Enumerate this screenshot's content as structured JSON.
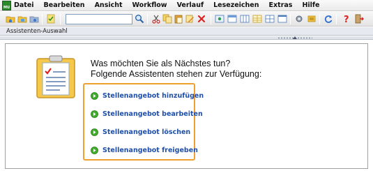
{
  "app": {
    "logo_text": "MU"
  },
  "menu": {
    "items": [
      {
        "label": "Datei"
      },
      {
        "label": "Bearbeiten"
      },
      {
        "label": "Ansicht"
      },
      {
        "label": "Workflow"
      },
      {
        "label": "Verlauf"
      },
      {
        "label": "Lesezeichen"
      },
      {
        "label": "Extras"
      },
      {
        "label": "Hilfe"
      }
    ]
  },
  "toolbar": {
    "search_value": "",
    "icons": [
      "home-folder-icon",
      "open-folder-icon",
      "folder-icon",
      "checklist-icon",
      "search-icon",
      "cut-icon",
      "copy-icon",
      "paste-icon",
      "edit-icon",
      "delete-icon",
      "view-icon",
      "layout-icon",
      "columns-icon",
      "table-icon",
      "grid-icon",
      "window-icon",
      "settings-icon",
      "tools-icon",
      "refresh-icon",
      "help-icon",
      "exit-icon"
    ]
  },
  "panel": {
    "title": "Assistenten-Auswahl"
  },
  "main": {
    "heading_line1": "Was möchten Sie als Nächstes tun?",
    "heading_line2": "Folgende Assistenten stehen zur Verfügung:",
    "wizards": [
      {
        "label": "Stellenangebot hinzufügen"
      },
      {
        "label": "Stellenangebot bearbeiten"
      },
      {
        "label": "Stellenangebot löschen"
      },
      {
        "label": "Stellenangebot freigeben"
      }
    ]
  },
  "colors": {
    "accent_border": "#f0a030",
    "link": "#1f4fa8",
    "go_icon": "#3fae2a"
  }
}
